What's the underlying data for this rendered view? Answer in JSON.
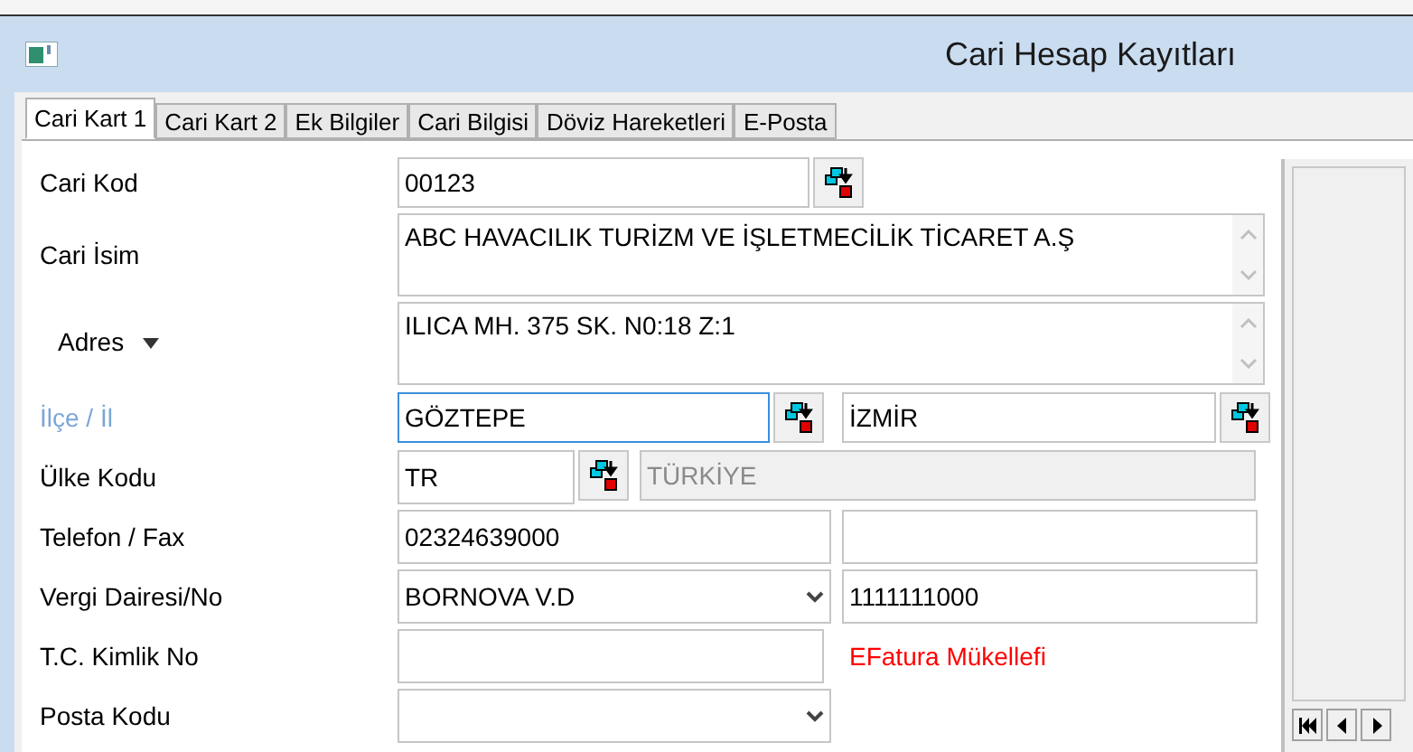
{
  "window": {
    "title": "Cari Hesap Kayıtları"
  },
  "tabs": [
    {
      "label": "Cari Kart 1",
      "selected": true
    },
    {
      "label": "Cari Kart 2",
      "selected": false
    },
    {
      "label": "Ek Bilgiler",
      "selected": false
    },
    {
      "label": "Cari Bilgisi",
      "selected": false
    },
    {
      "label": "Döviz Hareketleri",
      "selected": false
    },
    {
      "label": "E-Posta",
      "selected": false
    }
  ],
  "rows": [
    {
      "kind": "lookup",
      "label": "Cari Kod",
      "focused": false,
      "value": "00123"
    },
    {
      "kind": "memo",
      "label": "Cari İsim",
      "focused": false,
      "value": "ABC HAVACILIK TURİZM VE İŞLETMECİLİK TİCARET A.Ş"
    },
    {
      "kind": "memo_menu",
      "label": "Adres",
      "focused": false,
      "value": "ILICA MH. 375 SK. N0:18 Z:1"
    },
    {
      "kind": "lookup_pair",
      "label": "İlçe / İl",
      "focused": true,
      "value": "GÖZTEPE",
      "value2": "İZMİR"
    },
    {
      "kind": "country",
      "label": "Ülke Kodu",
      "focused": false,
      "value": "TR",
      "value2": "TÜRKİYE"
    },
    {
      "kind": "pair",
      "label": "Telefon / Fax",
      "focused": false,
      "value": "02324639000"
    },
    {
      "kind": "combo_text",
      "label": "Vergi Dairesi/No",
      "focused": false,
      "value": "BORNOVA V.D",
      "value2": "1111111000"
    },
    {
      "kind": "text_note",
      "label": "T.C. Kimlik No",
      "focused": false,
      "note": "EFatura Mükellefi"
    },
    {
      "kind": "combo",
      "label": "Posta Kodu",
      "focused": false
    }
  ]
}
